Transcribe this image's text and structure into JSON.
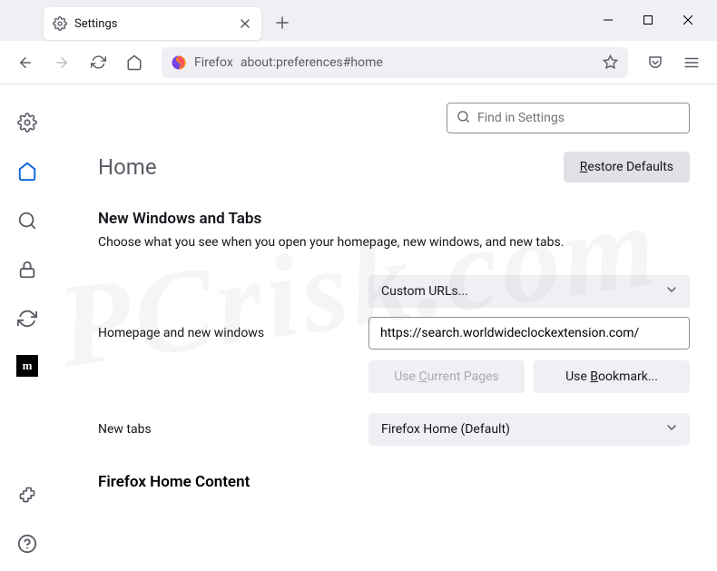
{
  "tab": {
    "title": "Settings"
  },
  "address": {
    "context": "Firefox",
    "url": "about:preferences#home"
  },
  "search": {
    "placeholder": "Find in Settings"
  },
  "page": {
    "title": "Home",
    "restore_label": "Restore Defaults",
    "section1_title": "New Windows and Tabs",
    "section1_desc": "Choose what you see when you open your homepage, new windows, and new tabs.",
    "homepage_label": "Homepage and new windows",
    "homepage_select": "Custom URLs...",
    "homepage_url": "https://search.worldwideclockextension.com/",
    "use_current": "Use Current Pages",
    "use_bookmark": "Use Bookmark...",
    "newtabs_label": "New tabs",
    "newtabs_select": "Firefox Home (Default)",
    "fh_content": "Firefox Home Content"
  },
  "watermark": "PCrisk.com"
}
